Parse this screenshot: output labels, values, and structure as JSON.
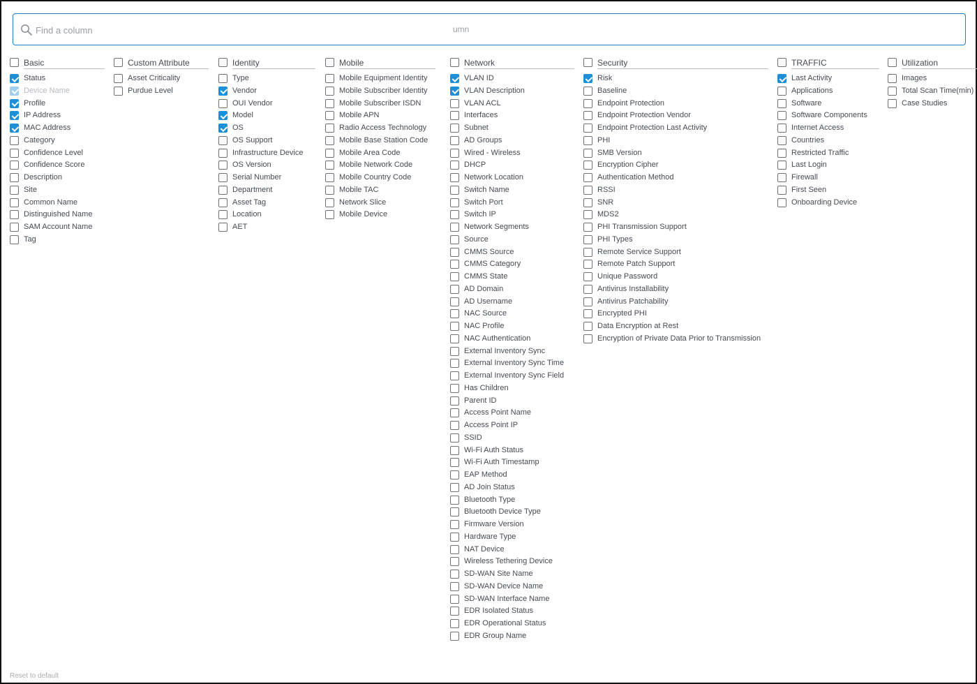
{
  "search": {
    "placeholder": "Find a column",
    "ghost_text": "umn"
  },
  "reset_label": "Reset to default",
  "groups": [
    {
      "title": "Basic",
      "checked": false,
      "items": [
        {
          "label": "Status",
          "checked": true
        },
        {
          "label": "Device Name",
          "checked": true,
          "disabled": true
        },
        {
          "label": "Profile",
          "checked": true
        },
        {
          "label": "IP Address",
          "checked": true
        },
        {
          "label": "MAC Address",
          "checked": true
        },
        {
          "label": "Category",
          "checked": false
        },
        {
          "label": "Confidence Level",
          "checked": false
        },
        {
          "label": "Confidence Score",
          "checked": false
        },
        {
          "label": "Description",
          "checked": false
        },
        {
          "label": "Site",
          "checked": false
        },
        {
          "label": "Common Name",
          "checked": false
        },
        {
          "label": "Distinguished Name",
          "checked": false
        },
        {
          "label": "SAM Account Name",
          "checked": false
        },
        {
          "label": "Tag",
          "checked": false
        }
      ]
    },
    {
      "title": "Custom Attribute",
      "checked": false,
      "items": [
        {
          "label": "Asset Criticality",
          "checked": false
        },
        {
          "label": "Purdue Level",
          "checked": false
        }
      ]
    },
    {
      "title": "Identity",
      "checked": false,
      "items": [
        {
          "label": "Type",
          "checked": false
        },
        {
          "label": "Vendor",
          "checked": true
        },
        {
          "label": "OUI Vendor",
          "checked": false
        },
        {
          "label": "Model",
          "checked": true
        },
        {
          "label": "OS",
          "checked": true
        },
        {
          "label": "OS Support",
          "checked": false
        },
        {
          "label": "Infrastructure Device",
          "checked": false
        },
        {
          "label": "OS Version",
          "checked": false
        },
        {
          "label": "Serial Number",
          "checked": false
        },
        {
          "label": "Department",
          "checked": false
        },
        {
          "label": "Asset Tag",
          "checked": false
        },
        {
          "label": "Location",
          "checked": false
        },
        {
          "label": "AET",
          "checked": false
        }
      ]
    },
    {
      "title": "Mobile",
      "checked": false,
      "items": [
        {
          "label": "Mobile Equipment Identity",
          "checked": false
        },
        {
          "label": "Mobile Subscriber Identity",
          "checked": false
        },
        {
          "label": "Mobile Subscriber ISDN",
          "checked": false
        },
        {
          "label": "Mobile APN",
          "checked": false
        },
        {
          "label": "Radio Access Technology",
          "checked": false
        },
        {
          "label": "Mobile Base Station Code",
          "checked": false
        },
        {
          "label": "Mobile Area Code",
          "checked": false
        },
        {
          "label": "Mobile Network Code",
          "checked": false
        },
        {
          "label": "Mobile Country Code",
          "checked": false
        },
        {
          "label": "Mobile TAC",
          "checked": false
        },
        {
          "label": "Network Slice",
          "checked": false
        },
        {
          "label": "Mobile Device",
          "checked": false
        }
      ]
    },
    {
      "title": "Network",
      "checked": false,
      "items": [
        {
          "label": "VLAN ID",
          "checked": true
        },
        {
          "label": "VLAN Description",
          "checked": true
        },
        {
          "label": "VLAN ACL",
          "checked": false
        },
        {
          "label": "Interfaces",
          "checked": false
        },
        {
          "label": "Subnet",
          "checked": false
        },
        {
          "label": "AD Groups",
          "checked": false
        },
        {
          "label": "Wired - Wireless",
          "checked": false
        },
        {
          "label": "DHCP",
          "checked": false
        },
        {
          "label": "Network Location",
          "checked": false
        },
        {
          "label": "Switch Name",
          "checked": false
        },
        {
          "label": "Switch Port",
          "checked": false
        },
        {
          "label": "Switch IP",
          "checked": false
        },
        {
          "label": "Network Segments",
          "checked": false
        },
        {
          "label": "Source",
          "checked": false
        },
        {
          "label": "CMMS Source",
          "checked": false
        },
        {
          "label": "CMMS Category",
          "checked": false
        },
        {
          "label": "CMMS State",
          "checked": false
        },
        {
          "label": "AD Domain",
          "checked": false
        },
        {
          "label": "AD Username",
          "checked": false
        },
        {
          "label": "NAC Source",
          "checked": false
        },
        {
          "label": "NAC Profile",
          "checked": false
        },
        {
          "label": "NAC Authentication",
          "checked": false
        },
        {
          "label": "External Inventory Sync",
          "checked": false
        },
        {
          "label": "External Inventory Sync Time",
          "checked": false
        },
        {
          "label": "External Inventory Sync Field",
          "checked": false
        },
        {
          "label": "Has Children",
          "checked": false
        },
        {
          "label": "Parent ID",
          "checked": false
        },
        {
          "label": "Access Point Name",
          "checked": false
        },
        {
          "label": "Access Point IP",
          "checked": false
        },
        {
          "label": "SSID",
          "checked": false
        },
        {
          "label": "Wi-Fi Auth Status",
          "checked": false
        },
        {
          "label": "Wi-Fi Auth Timestamp",
          "checked": false
        },
        {
          "label": "EAP Method",
          "checked": false
        },
        {
          "label": "AD Join Status",
          "checked": false
        },
        {
          "label": "Bluetooth Type",
          "checked": false
        },
        {
          "label": "Bluetooth Device Type",
          "checked": false
        },
        {
          "label": "Firmware Version",
          "checked": false
        },
        {
          "label": "Hardware Type",
          "checked": false
        },
        {
          "label": "NAT Device",
          "checked": false
        },
        {
          "label": "Wireless Tethering Device",
          "checked": false
        },
        {
          "label": "SD-WAN Site Name",
          "checked": false
        },
        {
          "label": "SD-WAN Device Name",
          "checked": false
        },
        {
          "label": "SD-WAN Interface Name",
          "checked": false
        },
        {
          "label": "EDR Isolated Status",
          "checked": false
        },
        {
          "label": "EDR Operational Status",
          "checked": false
        },
        {
          "label": "EDR Group Name",
          "checked": false
        }
      ]
    },
    {
      "title": "Security",
      "checked": false,
      "items": [
        {
          "label": "Risk",
          "checked": true
        },
        {
          "label": "Baseline",
          "checked": false
        },
        {
          "label": "Endpoint Protection",
          "checked": false
        },
        {
          "label": "Endpoint Protection Vendor",
          "checked": false
        },
        {
          "label": "Endpoint Protection Last Activity",
          "checked": false
        },
        {
          "label": "PHI",
          "checked": false
        },
        {
          "label": "SMB Version",
          "checked": false
        },
        {
          "label": "Encryption Cipher",
          "checked": false
        },
        {
          "label": "Authentication Method",
          "checked": false
        },
        {
          "label": "RSSI",
          "checked": false
        },
        {
          "label": "SNR",
          "checked": false
        },
        {
          "label": "MDS2",
          "checked": false
        },
        {
          "label": "PHI Transmission Support",
          "checked": false
        },
        {
          "label": "PHI Types",
          "checked": false
        },
        {
          "label": "Remote Service Support",
          "checked": false
        },
        {
          "label": "Remote Patch Support",
          "checked": false
        },
        {
          "label": "Unique Password",
          "checked": false
        },
        {
          "label": "Antivirus Installability",
          "checked": false
        },
        {
          "label": "Antivirus Patchability",
          "checked": false
        },
        {
          "label": "Encrypted PHI",
          "checked": false
        },
        {
          "label": "Data Encryption at Rest",
          "checked": false
        },
        {
          "label": "Encryption of Private Data Prior to Transmission",
          "checked": false
        }
      ]
    },
    {
      "title": "TRAFFIC",
      "checked": false,
      "items": [
        {
          "label": "Last Activity",
          "checked": true
        },
        {
          "label": "Applications",
          "checked": false
        },
        {
          "label": "Software",
          "checked": false
        },
        {
          "label": "Software Components",
          "checked": false
        },
        {
          "label": "Internet Access",
          "checked": false
        },
        {
          "label": "Countries",
          "checked": false
        },
        {
          "label": "Restricted Traffic",
          "checked": false
        },
        {
          "label": "Last Login",
          "checked": false
        },
        {
          "label": "Firewall",
          "checked": false
        },
        {
          "label": "First Seen",
          "checked": false
        },
        {
          "label": "Onboarding Device",
          "checked": false
        }
      ]
    },
    {
      "title": "Utilization",
      "checked": false,
      "items": [
        {
          "label": "Images",
          "checked": false
        },
        {
          "label": "Total Scan Time(min)",
          "checked": false
        },
        {
          "label": "Case Studies",
          "checked": false
        }
      ]
    }
  ]
}
